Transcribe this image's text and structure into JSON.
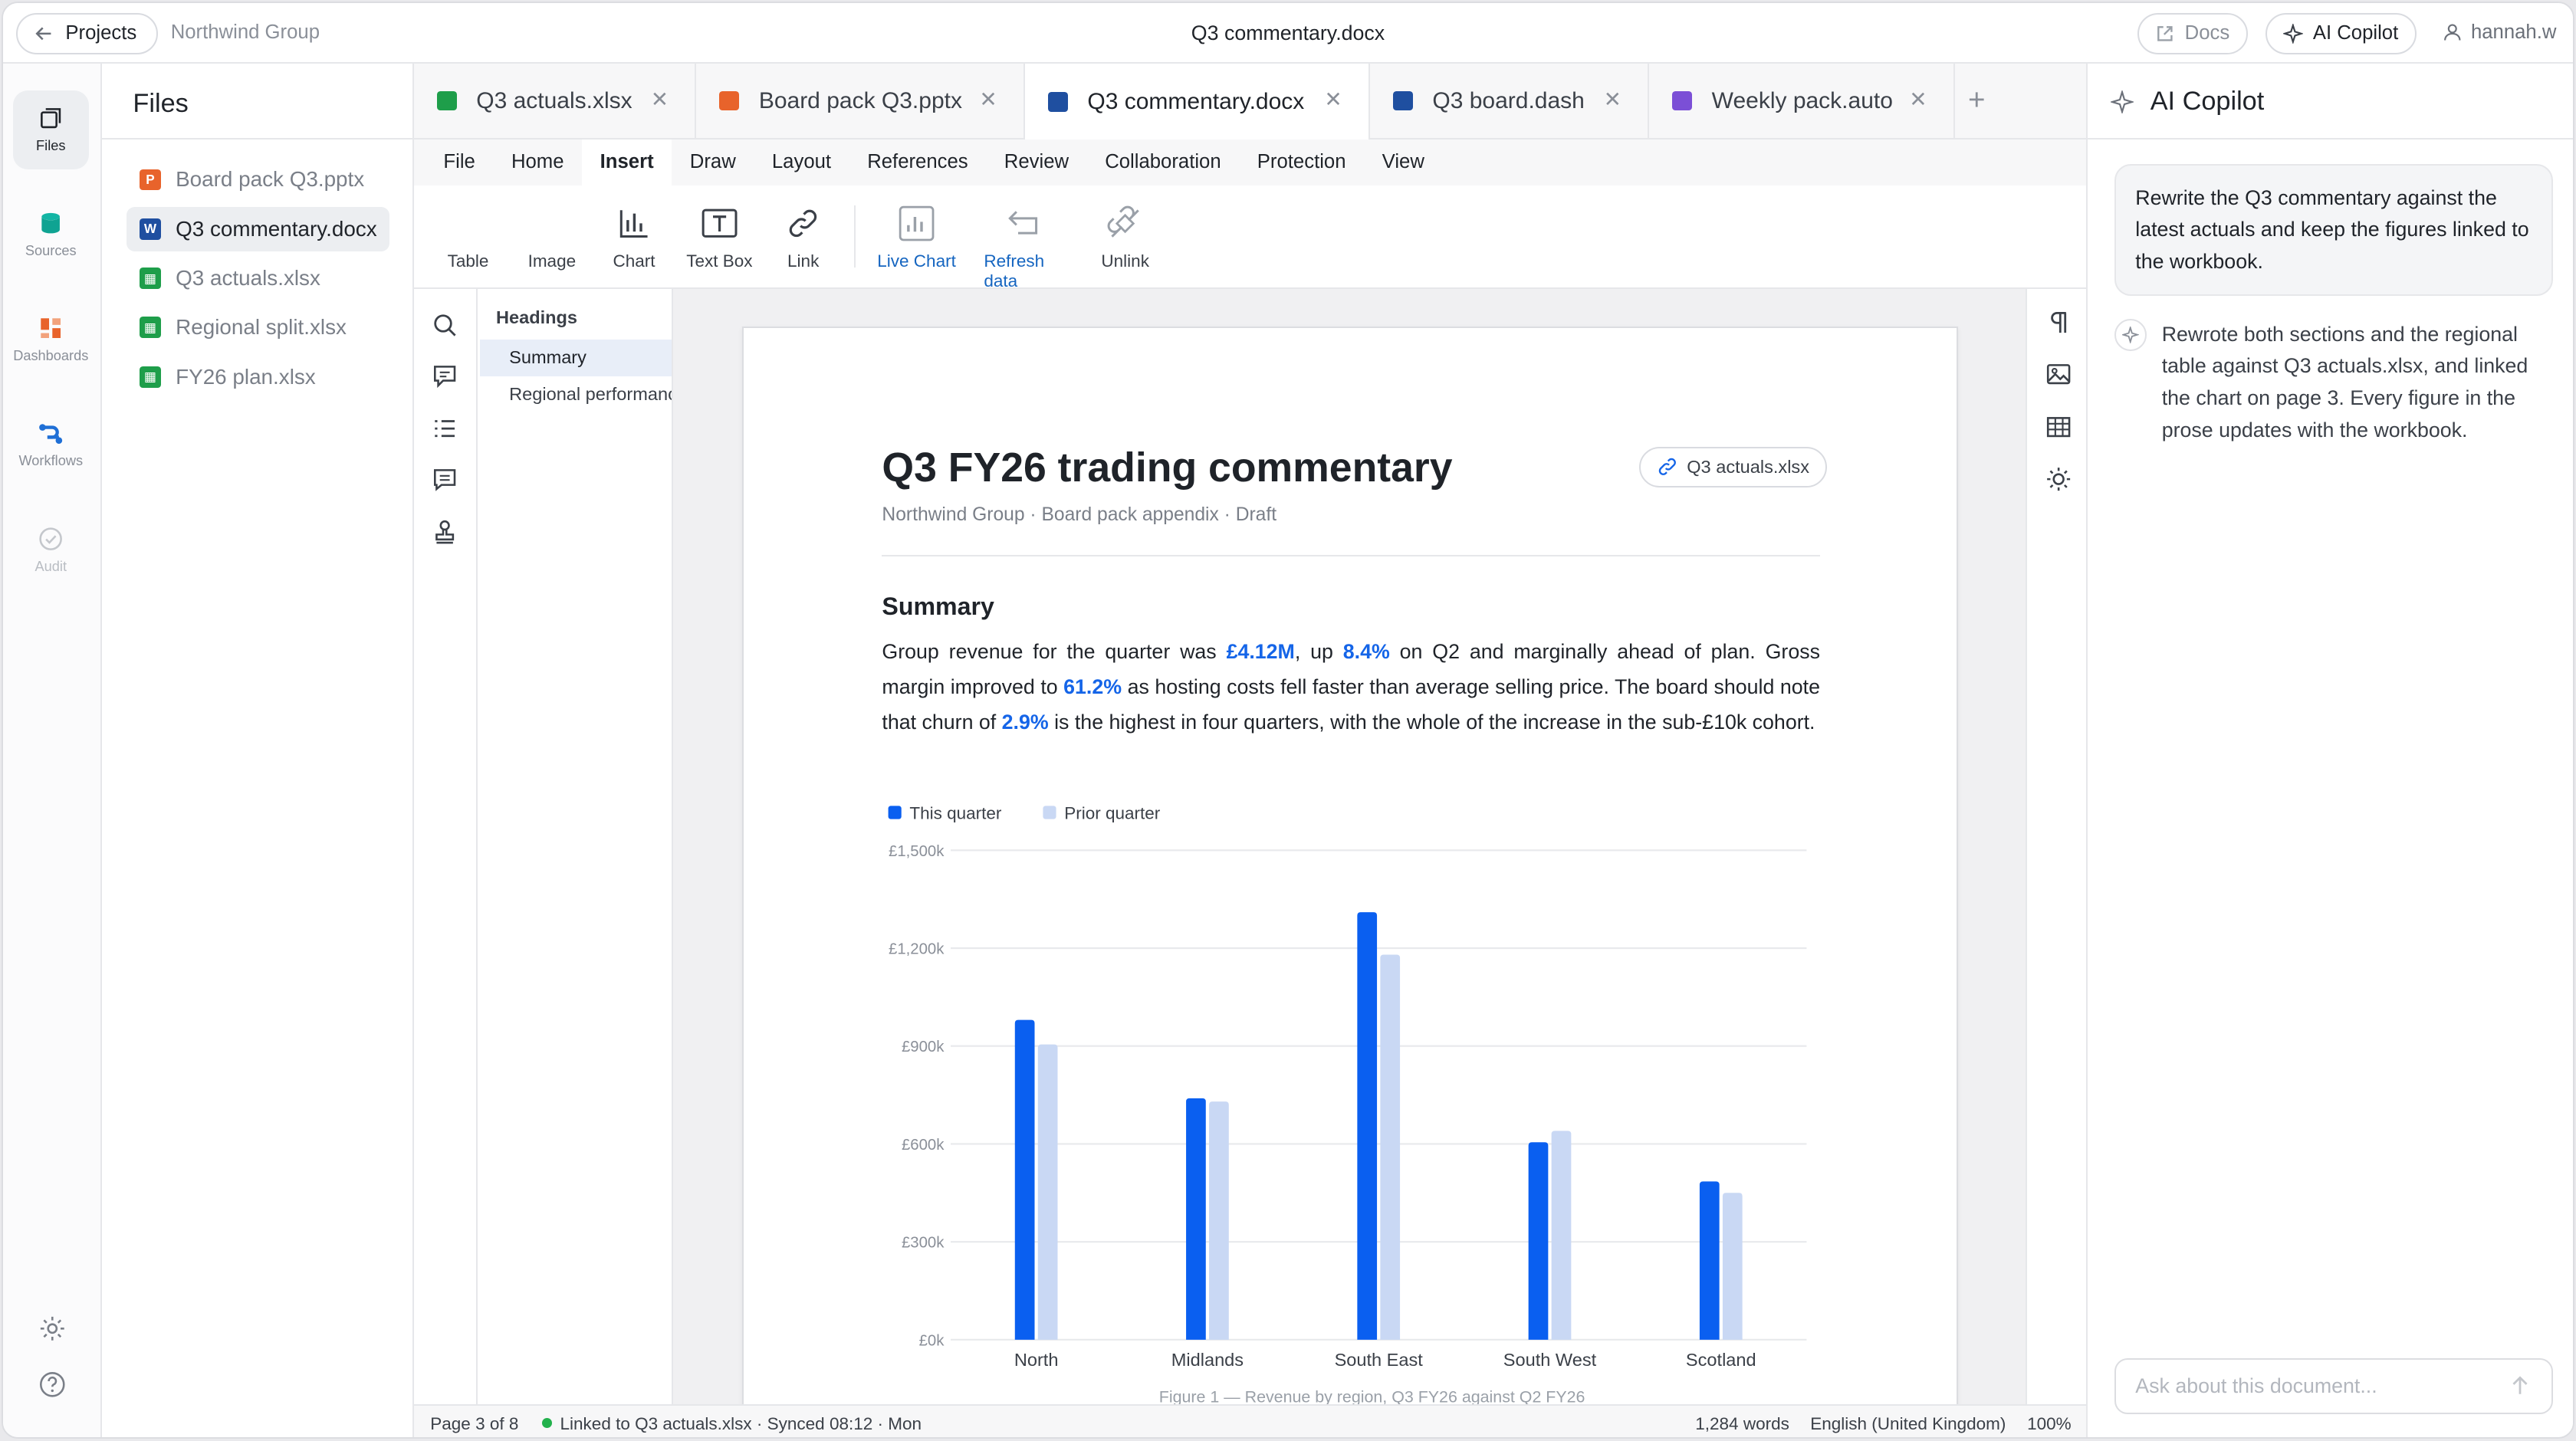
{
  "topbar": {
    "projects_label": "Projects",
    "breadcrumb": "Northwind Group",
    "doc_title": "Q3 commentary.docx",
    "docs_label": "Docs",
    "copilot_label": "AI Copilot",
    "user": "hannah.w"
  },
  "rail": [
    {
      "label": "Files",
      "icon": "files-icon"
    },
    {
      "label": "Sources",
      "icon": "database-icon"
    },
    {
      "label": "Dashboards",
      "icon": "dashboard-icon"
    },
    {
      "label": "Workflows",
      "icon": "workflow-icon"
    },
    {
      "label": "Audit",
      "icon": "check-circle-icon"
    }
  ],
  "files": {
    "title": "Files",
    "items": [
      {
        "name": "Board pack Q3.pptx",
        "kind": "pptx"
      },
      {
        "name": "Q3 commentary.docx",
        "kind": "docx"
      },
      {
        "name": "Q3 actuals.xlsx",
        "kind": "xlsx"
      },
      {
        "name": "Regional split.xlsx",
        "kind": "xlsx"
      },
      {
        "name": "FY26 plan.xlsx",
        "kind": "xlsx"
      }
    ]
  },
  "tabs": [
    {
      "label": "Q3 actuals.xlsx",
      "kind": "xlsx"
    },
    {
      "label": "Board pack Q3.pptx",
      "kind": "pptx"
    },
    {
      "label": "Q3 commentary.docx",
      "kind": "docx"
    },
    {
      "label": "Q3 board.dash",
      "kind": "dash"
    },
    {
      "label": "Weekly pack.auto",
      "kind": "auto"
    }
  ],
  "menu": [
    "File",
    "Home",
    "Insert",
    "Draw",
    "Layout",
    "References",
    "Review",
    "Collaboration",
    "Protection",
    "View"
  ],
  "ribbon": [
    "Table",
    "Image",
    "Chart",
    "Text Box",
    "Link",
    "Live Chart",
    "Refresh data",
    "Unlink"
  ],
  "outline": {
    "heading": "Headings",
    "items": [
      "Summary",
      "Regional performance"
    ]
  },
  "document": {
    "title": "Q3 FY26 trading commentary",
    "linked_file": "Q3 actuals.xlsx",
    "meta": "Northwind Group · Board pack appendix · Draft",
    "section": "Summary",
    "p1": "Group revenue for the quarter was ",
    "v1": "£4.12M",
    "p2": ", up ",
    "v2": "8.4%",
    "p3": " on Q2 and marginally ahead of plan. Gross margin improved to ",
    "v3": "61.2%",
    "p4": " as hosting costs fell faster than average selling price. The board should note that churn of ",
    "v4": "2.9%",
    "p5": " is the highest in four quarters, with the whole of the increase in the sub-£10k cohort."
  },
  "chart_data": {
    "type": "bar",
    "categories": [
      "North",
      "Midlands",
      "South East",
      "South West",
      "Scotland"
    ],
    "series": [
      {
        "name": "This quarter",
        "color": "#0a5ff0",
        "values": [
          980,
          740,
          1310,
          605,
          485
        ]
      },
      {
        "name": "Prior quarter",
        "color": "#c9d8f4",
        "values": [
          905,
          730,
          1180,
          640,
          450
        ]
      }
    ],
    "yticks": [
      "£0k",
      "£300k",
      "£600k",
      "£900k",
      "£1,200k",
      "£1,500k"
    ],
    "ylim": [
      0,
      1500
    ],
    "grid": true,
    "legend": "top-left",
    "caption": "Figure 1 — Revenue by region, Q3 FY26 against Q2 FY26"
  },
  "status": {
    "page": "Page 3 of 8",
    "link": "Linked to Q3 actuals.xlsx · Synced 08:12 · Mon",
    "words": "1,284 words",
    "lang": "English (United Kingdom)",
    "zoom": "100%"
  },
  "copilot": {
    "title": "AI Copilot",
    "user_msg": "Rewrite the Q3 commentary against the latest actuals and keep the figures linked to the workbook.",
    "reply": "Rewrote both sections and the regional table against Q3 actuals.xlsx, and linked the chart on page 3. Every figure in the prose updates with the workbook.",
    "placeholder": "Ask about this document..."
  }
}
